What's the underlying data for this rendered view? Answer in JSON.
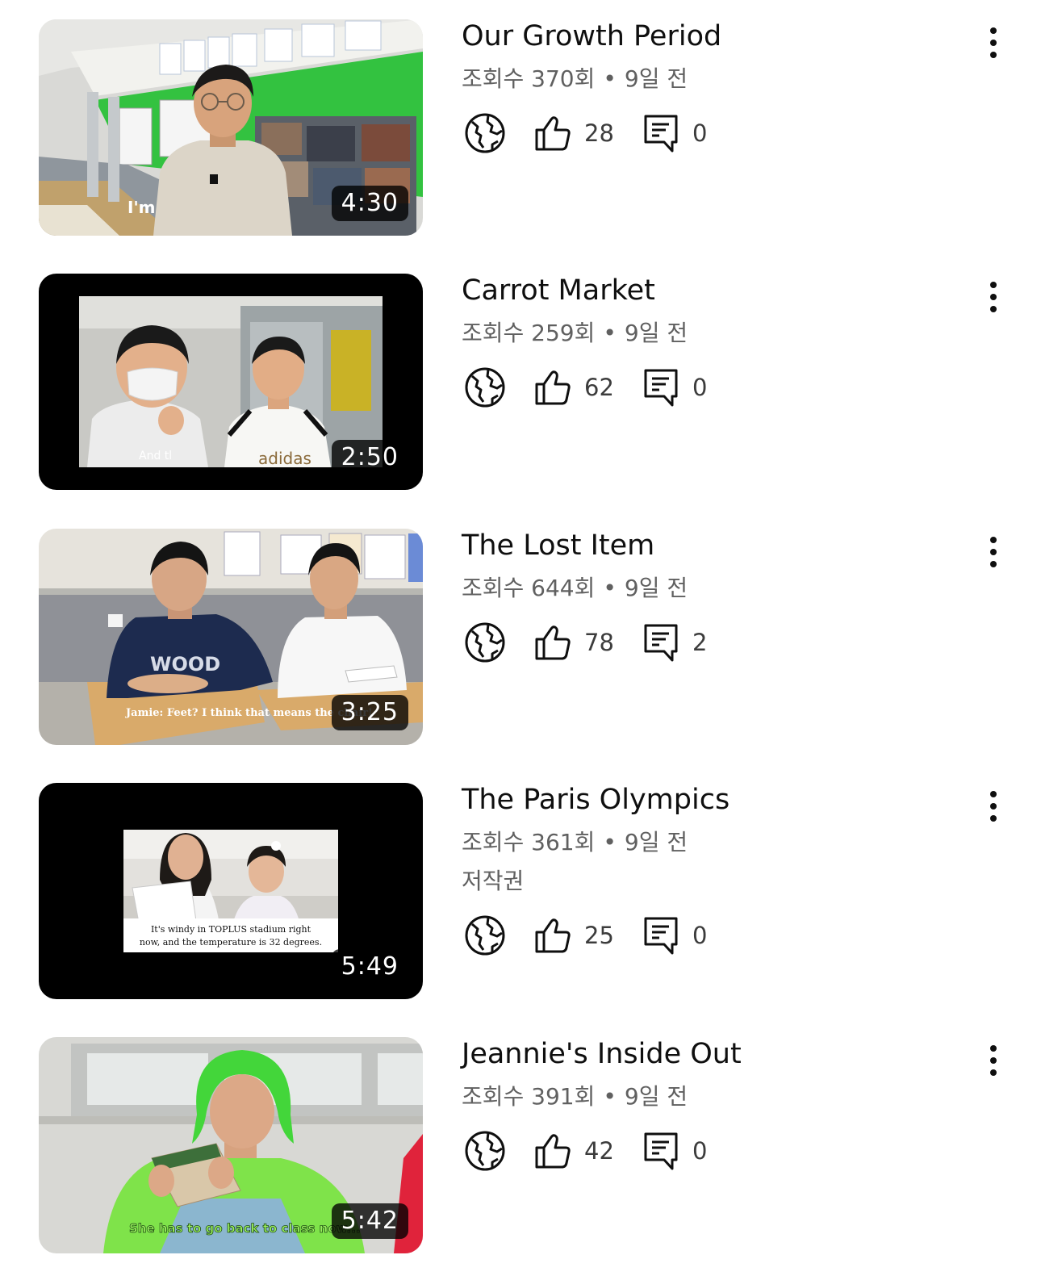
{
  "videos": [
    {
      "title": "Our Growth Period",
      "views": "조회수 370회",
      "separator": "•",
      "age": "9일 전",
      "extra": "",
      "duration": "4:30",
      "likes": "28",
      "comments": "0",
      "caption": "I'm"
    },
    {
      "title": "Carrot Market",
      "views": "조회수 259회",
      "separator": "•",
      "age": "9일 전",
      "extra": "",
      "duration": "2:50",
      "likes": "62",
      "comments": "0",
      "caption": "And tl",
      "shirt_text": "adidas"
    },
    {
      "title": "The Lost Item",
      "views": "조회수 644회",
      "separator": "•",
      "age": "9일 전",
      "extra": "",
      "duration": "3:25",
      "likes": "78",
      "comments": "2",
      "caption": "Jamie: Feet? I think that means the chair!"
    },
    {
      "title": "The Paris Olympics",
      "views": "조회수 361회",
      "separator": "•",
      "age": "9일 전",
      "extra": "저작권",
      "duration": "5:49",
      "likes": "25",
      "comments": "0",
      "caption_line1": "It's windy in TOPLUS stadium right",
      "caption_line2": "now, and the temperature is 32 degrees."
    },
    {
      "title": "Jeannie's Inside Out",
      "views": "조회수 391회",
      "separator": "•",
      "age": "9일 전",
      "extra": "",
      "duration": "5:42",
      "likes": "42",
      "comments": "0",
      "caption": "She has to go back to class now..."
    }
  ],
  "icons": {
    "visibility": "globe-icon",
    "like": "thumbs-up-icon",
    "comment": "comment-icon",
    "more": "more-vertical-icon"
  },
  "colors": {
    "title": "#0f0f0f",
    "meta": "#606060",
    "icon": "#0f0f0f",
    "duration_bg": "#000000"
  }
}
